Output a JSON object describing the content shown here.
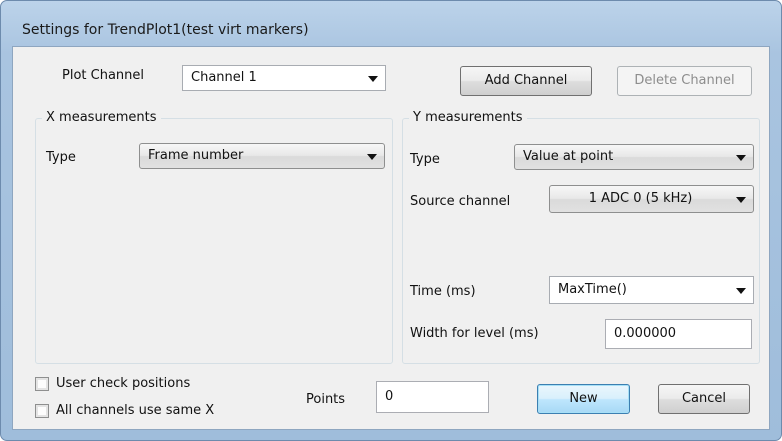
{
  "window": {
    "title": "Settings for TrendPlot1(test virt markers)"
  },
  "plot_channel": {
    "label": "Plot Channel",
    "value": "Channel 1"
  },
  "buttons": {
    "add_channel": "Add Channel",
    "delete_channel": "Delete Channel",
    "new": "New",
    "cancel": "Cancel"
  },
  "x_measurements": {
    "title": "X measurements",
    "type_label": "Type",
    "type_value": "Frame number"
  },
  "y_measurements": {
    "title": "Y measurements",
    "type_label": "Type",
    "type_value": "Value at point",
    "source_label": "Source channel",
    "source_value": "1 ADC 0 (5 kHz)",
    "time_label": "Time (ms)",
    "time_value": "MaxTime()",
    "width_label": "Width for level (ms)",
    "width_value": "0.000000"
  },
  "options": {
    "user_check_positions": "User check positions",
    "all_channels_same_x": "All channels use same X"
  },
  "points": {
    "label": "Points",
    "value": "0"
  },
  "colors": {
    "title_bar": "#a9c4e0",
    "dialog_bg": "#f0f0f0",
    "default_button_border": "#3c7fb1",
    "disabled_text": "#8d8d8d"
  }
}
